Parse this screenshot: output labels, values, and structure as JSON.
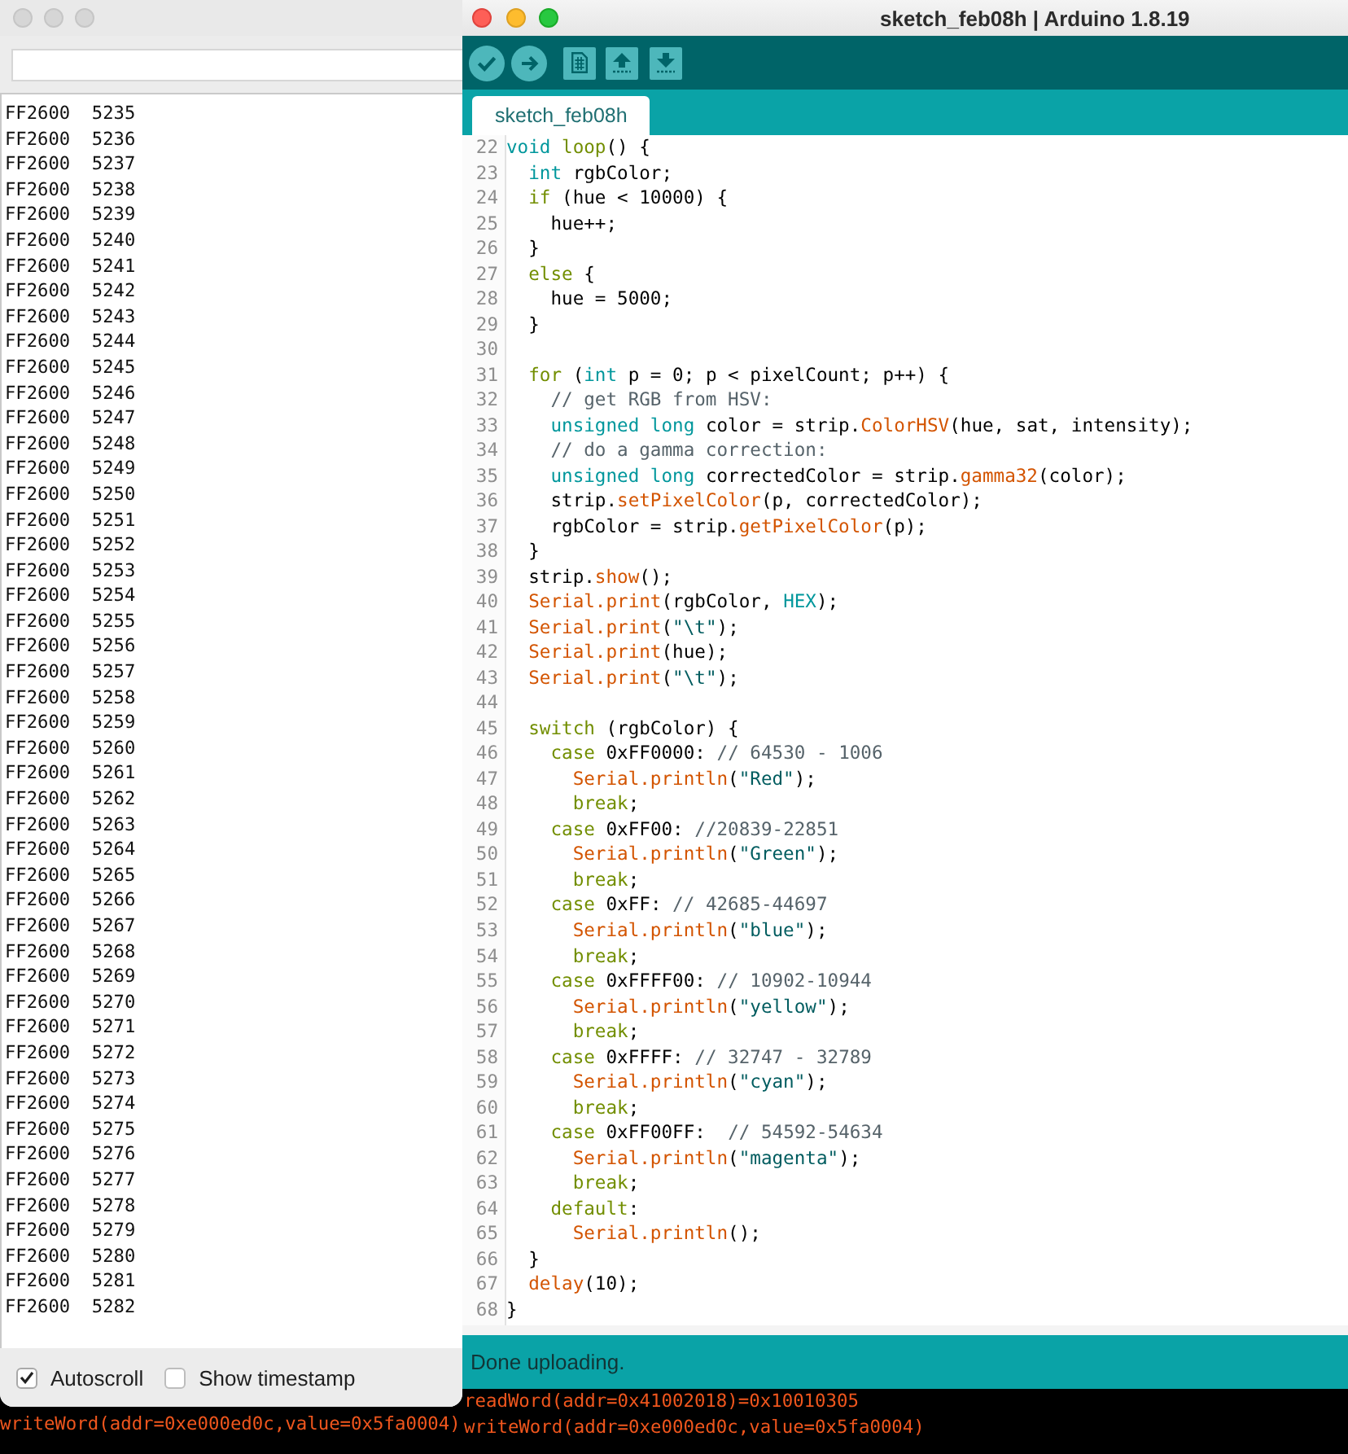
{
  "serial_monitor": {
    "output_lines": [
      "FF2600  5235",
      "FF2600  5236",
      "FF2600  5237",
      "FF2600  5238",
      "FF2600  5239",
      "FF2600  5240",
      "FF2600  5241",
      "FF2600  5242",
      "FF2600  5243",
      "FF2600  5244",
      "FF2600  5245",
      "FF2600  5246",
      "FF2600  5247",
      "FF2600  5248",
      "FF2600  5249",
      "FF2600  5250",
      "FF2600  5251",
      "FF2600  5252",
      "FF2600  5253",
      "FF2600  5254",
      "FF2600  5255",
      "FF2600  5256",
      "FF2600  5257",
      "FF2600  5258",
      "FF2600  5259",
      "FF2600  5260",
      "FF2600  5261",
      "FF2600  5262",
      "FF2600  5263",
      "FF2600  5264",
      "FF2600  5265",
      "FF2600  5266",
      "FF2600  5267",
      "FF2600  5268",
      "FF2600  5269",
      "FF2600  5270",
      "FF2600  5271",
      "FF2600  5272",
      "FF2600  5273",
      "FF2600  5274",
      "FF2600  5275",
      "FF2600  5276",
      "FF2600  5277",
      "FF2600  5278",
      "FF2600  5279",
      "FF2600  5280",
      "FF2600  5281",
      "FF2600  5282"
    ],
    "options": [
      {
        "label": "Autoscroll",
        "checked": true
      },
      {
        "label": "Show timestamp",
        "checked": false
      }
    ]
  },
  "background_console": {
    "lines": [
      "writeWord(addr=0xe000ed0c,value=0x5fa0004)"
    ]
  },
  "arduino_window": {
    "title": "sketch_feb08h | Arduino 1.8.19",
    "tabs": [
      {
        "label": "sketch_feb08h",
        "selected": true
      }
    ],
    "editor": {
      "lines": [
        {
          "number": "22",
          "tokens": [
            {
              "kind": "type",
              "text": "void"
            },
            {
              "kind": "keyword",
              "text": " loop"
            },
            {
              "kind": "plain",
              "text": "() {"
            }
          ]
        },
        {
          "number": "23",
          "tokens": [
            {
              "kind": "type",
              "text": "  int"
            },
            {
              "kind": "plain",
              "text": " rgbColor;"
            }
          ]
        },
        {
          "number": "24",
          "tokens": [
            {
              "kind": "keyword",
              "text": "  if"
            },
            {
              "kind": "plain",
              "text": " (hue < 10000) {"
            }
          ]
        },
        {
          "number": "25",
          "tokens": [
            {
              "kind": "plain",
              "text": "    hue++;"
            }
          ]
        },
        {
          "number": "26",
          "tokens": [
            {
              "kind": "plain",
              "text": "  }"
            }
          ]
        },
        {
          "number": "27",
          "tokens": [
            {
              "kind": "keyword",
              "text": "  else"
            },
            {
              "kind": "plain",
              "text": " {"
            }
          ]
        },
        {
          "number": "28",
          "tokens": [
            {
              "kind": "plain",
              "text": "    hue = 5000;"
            }
          ]
        },
        {
          "number": "29",
          "tokens": [
            {
              "kind": "plain",
              "text": "  }"
            }
          ]
        },
        {
          "number": "30"
        },
        {
          "number": "31",
          "tokens": [
            {
              "kind": "keyword",
              "text": "  for"
            },
            {
              "kind": "plain",
              "text": " ("
            },
            {
              "kind": "type",
              "text": "int"
            },
            {
              "kind": "plain",
              "text": " p = 0; p < pixelCount; p++) {"
            }
          ]
        },
        {
          "number": "32",
          "tokens": [
            {
              "kind": "comment",
              "text": "    // get RGB from HSV:"
            }
          ]
        },
        {
          "number": "33",
          "tokens": [
            {
              "kind": "type",
              "text": "    unsigned long"
            },
            {
              "kind": "plain",
              "text": " color = strip."
            },
            {
              "kind": "function",
              "text": "ColorHSV"
            },
            {
              "kind": "plain",
              "text": "(hue, sat, intensity);"
            }
          ]
        },
        {
          "number": "34",
          "tokens": [
            {
              "kind": "comment",
              "text": "    // do a gamma correction:"
            }
          ]
        },
        {
          "number": "35",
          "tokens": [
            {
              "kind": "type",
              "text": "    unsigned long"
            },
            {
              "kind": "plain",
              "text": " correctedColor = strip."
            },
            {
              "kind": "function",
              "text": "gamma32"
            },
            {
              "kind": "plain",
              "text": "(color);"
            }
          ]
        },
        {
          "number": "36",
          "tokens": [
            {
              "kind": "plain",
              "text": "    strip."
            },
            {
              "kind": "function",
              "text": "setPixelColor"
            },
            {
              "kind": "plain",
              "text": "(p, correctedColor);"
            }
          ]
        },
        {
          "number": "37",
          "tokens": [
            {
              "kind": "plain",
              "text": "    rgbColor = strip."
            },
            {
              "kind": "function",
              "text": "getPixelColor"
            },
            {
              "kind": "plain",
              "text": "(p);"
            }
          ]
        },
        {
          "number": "38",
          "tokens": [
            {
              "kind": "plain",
              "text": "  }"
            }
          ]
        },
        {
          "number": "39",
          "tokens": [
            {
              "kind": "plain",
              "text": "  strip."
            },
            {
              "kind": "function",
              "text": "show"
            },
            {
              "kind": "plain",
              "text": "();"
            }
          ]
        },
        {
          "number": "40",
          "tokens": [
            {
              "kind": "function",
              "text": "  Serial.print"
            },
            {
              "kind": "plain",
              "text": "(rgbColor, "
            },
            {
              "kind": "constant",
              "text": "HEX"
            },
            {
              "kind": "plain",
              "text": ");"
            }
          ]
        },
        {
          "number": "41",
          "tokens": [
            {
              "kind": "function",
              "text": "  Serial.print"
            },
            {
              "kind": "plain",
              "text": "("
            },
            {
              "kind": "string",
              "text": "\"\\t\""
            },
            {
              "kind": "plain",
              "text": ");"
            }
          ]
        },
        {
          "number": "42",
          "tokens": [
            {
              "kind": "function",
              "text": "  Serial.print"
            },
            {
              "kind": "plain",
              "text": "(hue);"
            }
          ]
        },
        {
          "number": "43",
          "tokens": [
            {
              "kind": "function",
              "text": "  Serial.print"
            },
            {
              "kind": "plain",
              "text": "("
            },
            {
              "kind": "string",
              "text": "\"\\t\""
            },
            {
              "kind": "plain",
              "text": ");"
            }
          ]
        },
        {
          "number": "44"
        },
        {
          "number": "45",
          "tokens": [
            {
              "kind": "keyword",
              "text": "  switch"
            },
            {
              "kind": "plain",
              "text": " (rgbColor) {"
            }
          ]
        },
        {
          "number": "46",
          "tokens": [
            {
              "kind": "keyword",
              "text": "    case"
            },
            {
              "kind": "plain",
              "text": " 0xFF0000: "
            },
            {
              "kind": "comment",
              "text": "// 64530 - 1006"
            }
          ]
        },
        {
          "number": "47",
          "tokens": [
            {
              "kind": "function",
              "text": "      Serial.println"
            },
            {
              "kind": "plain",
              "text": "("
            },
            {
              "kind": "string",
              "text": "\"Red\""
            },
            {
              "kind": "plain",
              "text": ");"
            }
          ]
        },
        {
          "number": "48",
          "tokens": [
            {
              "kind": "keyword",
              "text": "      break"
            },
            {
              "kind": "plain",
              "text": ";"
            }
          ]
        },
        {
          "number": "49",
          "tokens": [
            {
              "kind": "keyword",
              "text": "    case"
            },
            {
              "kind": "plain",
              "text": " 0xFF00: "
            },
            {
              "kind": "comment",
              "text": "//20839-22851"
            }
          ]
        },
        {
          "number": "50",
          "tokens": [
            {
              "kind": "function",
              "text": "      Serial.println"
            },
            {
              "kind": "plain",
              "text": "("
            },
            {
              "kind": "string",
              "text": "\"Green\""
            },
            {
              "kind": "plain",
              "text": ");"
            }
          ]
        },
        {
          "number": "51",
          "tokens": [
            {
              "kind": "keyword",
              "text": "      break"
            },
            {
              "kind": "plain",
              "text": ";"
            }
          ]
        },
        {
          "number": "52",
          "tokens": [
            {
              "kind": "keyword",
              "text": "    case"
            },
            {
              "kind": "plain",
              "text": " 0xFF: "
            },
            {
              "kind": "comment",
              "text": "// 42685-44697"
            }
          ]
        },
        {
          "number": "53",
          "tokens": [
            {
              "kind": "function",
              "text": "      Serial.println"
            },
            {
              "kind": "plain",
              "text": "("
            },
            {
              "kind": "string",
              "text": "\"blue\""
            },
            {
              "kind": "plain",
              "text": ");"
            }
          ]
        },
        {
          "number": "54",
          "tokens": [
            {
              "kind": "keyword",
              "text": "      break"
            },
            {
              "kind": "plain",
              "text": ";"
            }
          ]
        },
        {
          "number": "55",
          "tokens": [
            {
              "kind": "keyword",
              "text": "    case"
            },
            {
              "kind": "plain",
              "text": " 0xFFFF00: "
            },
            {
              "kind": "comment",
              "text": "// 10902-10944"
            }
          ]
        },
        {
          "number": "56",
          "tokens": [
            {
              "kind": "function",
              "text": "      Serial.println"
            },
            {
              "kind": "plain",
              "text": "("
            },
            {
              "kind": "string",
              "text": "\"yellow\""
            },
            {
              "kind": "plain",
              "text": ");"
            }
          ]
        },
        {
          "number": "57",
          "tokens": [
            {
              "kind": "keyword",
              "text": "      break"
            },
            {
              "kind": "plain",
              "text": ";"
            }
          ]
        },
        {
          "number": "58",
          "tokens": [
            {
              "kind": "keyword",
              "text": "    case"
            },
            {
              "kind": "plain",
              "text": " 0xFFFF: "
            },
            {
              "kind": "comment",
              "text": "// 32747 - 32789"
            }
          ]
        },
        {
          "number": "59",
          "tokens": [
            {
              "kind": "function",
              "text": "      Serial.println"
            },
            {
              "kind": "plain",
              "text": "("
            },
            {
              "kind": "string",
              "text": "\"cyan\""
            },
            {
              "kind": "plain",
              "text": ");"
            }
          ]
        },
        {
          "number": "60",
          "tokens": [
            {
              "kind": "keyword",
              "text": "      break"
            },
            {
              "kind": "plain",
              "text": ";"
            }
          ]
        },
        {
          "number": "61",
          "tokens": [
            {
              "kind": "keyword",
              "text": "    case"
            },
            {
              "kind": "plain",
              "text": " 0xFF00FF:  "
            },
            {
              "kind": "comment",
              "text": "// 54592-54634"
            }
          ]
        },
        {
          "number": "62",
          "tokens": [
            {
              "kind": "function",
              "text": "      Serial.println"
            },
            {
              "kind": "plain",
              "text": "("
            },
            {
              "kind": "string",
              "text": "\"magenta\""
            },
            {
              "kind": "plain",
              "text": ");"
            }
          ]
        },
        {
          "number": "63",
          "tokens": [
            {
              "kind": "keyword",
              "text": "      break"
            },
            {
              "kind": "plain",
              "text": ";"
            }
          ]
        },
        {
          "number": "64",
          "tokens": [
            {
              "kind": "keyword",
              "text": "    default"
            },
            {
              "kind": "plain",
              "text": ":"
            }
          ]
        },
        {
          "number": "65",
          "tokens": [
            {
              "kind": "function",
              "text": "      Serial.println"
            },
            {
              "kind": "plain",
              "text": "();"
            }
          ]
        },
        {
          "number": "66",
          "tokens": [
            {
              "kind": "plain",
              "text": "  }"
            }
          ]
        },
        {
          "number": "67",
          "tokens": [
            {
              "kind": "function",
              "text": "  delay"
            },
            {
              "kind": "plain",
              "text": "(10);"
            }
          ]
        },
        {
          "number": "68",
          "tokens": [
            {
              "kind": "plain",
              "text": "}"
            }
          ]
        }
      ]
    },
    "status": "Done uploading.",
    "console": {
      "lines": [
        "readWord(addr=0x41002018)=0x10010305",
        "writeWord(addr=0xe000ed0c,value=0x5fa0004)"
      ]
    }
  }
}
